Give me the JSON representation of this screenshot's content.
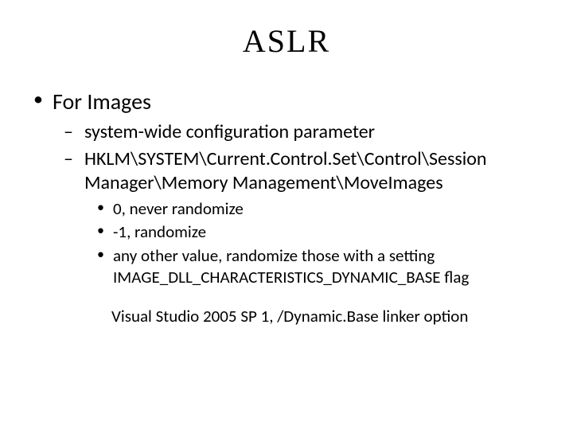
{
  "title": "ASLR",
  "bullets": {
    "l1_0": "For Images",
    "l2_0": "system-wide configuration parameter",
    "l2_1": "HKLM\\SYSTEM\\Current.Control.Set\\Control\\Session Manager\\Memory Management\\MoveImages",
    "l3_0": "0, never randomize",
    "l3_1": "-1, randomize",
    "l3_2": "any other value, randomize those with a setting IMAGE_DLL_CHARACTERISTICS_DYNAMIC_BASE flag",
    "foot": "Visual Studio 2005 SP 1, /Dynamic.Base linker option"
  }
}
